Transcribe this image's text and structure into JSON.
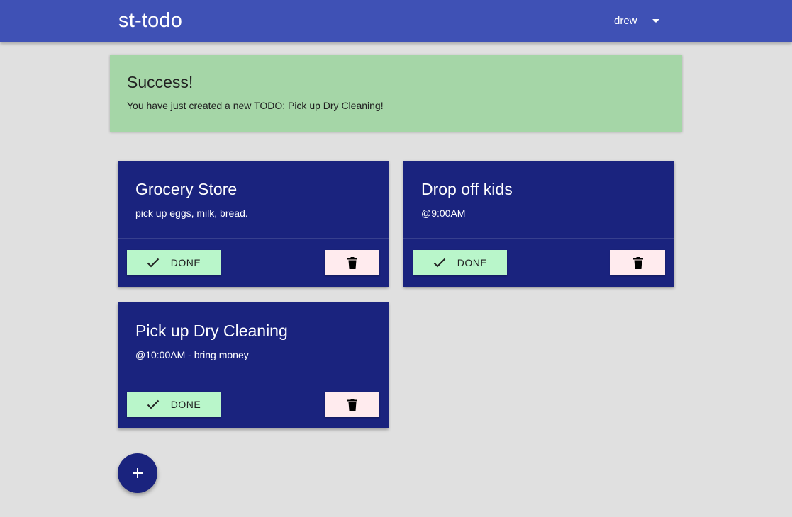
{
  "app": {
    "title": "st-todo",
    "user": "drew"
  },
  "alert": {
    "title": "Success!",
    "message": "You have just created a new TODO: Pick up Dry Cleaning!",
    "color": "#a5d6a7"
  },
  "todos": [
    {
      "title": "Grocery Store",
      "description": "pick up eggs, milk, bread.",
      "done_label": "DONE"
    },
    {
      "title": "Drop off kids",
      "description": "@9:00AM",
      "done_label": "DONE"
    },
    {
      "title": "Pick up Dry Cleaning",
      "description": "@10:00AM - bring money",
      "done_label": "DONE"
    }
  ],
  "icons": {
    "done": "check-icon",
    "delete": "trash-icon",
    "add": "plus-icon",
    "user_menu": "caret-down-icon"
  },
  "colors": {
    "appbar": "#3f51b5",
    "card": "#1a237e",
    "done_button": "#b9f6ca",
    "delete_button": "#ffebee",
    "background": "#e0e0e0"
  }
}
